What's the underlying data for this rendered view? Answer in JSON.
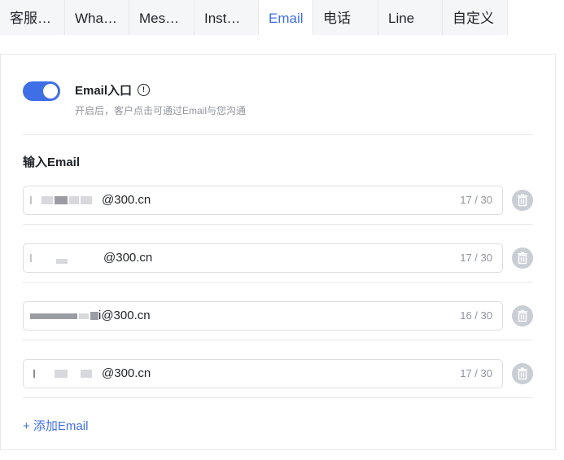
{
  "tabs": [
    {
      "label": "客服…"
    },
    {
      "label": "Wha…"
    },
    {
      "label": "Mes…"
    },
    {
      "label": "Inst…"
    },
    {
      "label": "Email",
      "active": true
    },
    {
      "label": "电话"
    },
    {
      "label": "Line"
    },
    {
      "label": "自定义"
    }
  ],
  "entry": {
    "title": "Email入口",
    "info_icon": "info-circle-icon",
    "description": "开启后，客户点击可通过Email与您沟通",
    "enabled": true
  },
  "section_title": "输入Email",
  "emails": [
    {
      "value": "@300.cn",
      "counter": "17 / 30"
    },
    {
      "value": "@300.cn",
      "counter": "17 / 30"
    },
    {
      "value": "i@300.cn",
      "counter": "16 / 30"
    },
    {
      "value": "@300.cn",
      "counter": "17 / 30"
    }
  ],
  "delete_icon": "trash-icon",
  "add_label": "+ 添加Email",
  "colors": {
    "accent": "#3f6fe6",
    "text": "#1f2329",
    "muted": "#8f959e",
    "border": "#e6e8eb",
    "delete_icon_bg": "#c9cdd4"
  }
}
